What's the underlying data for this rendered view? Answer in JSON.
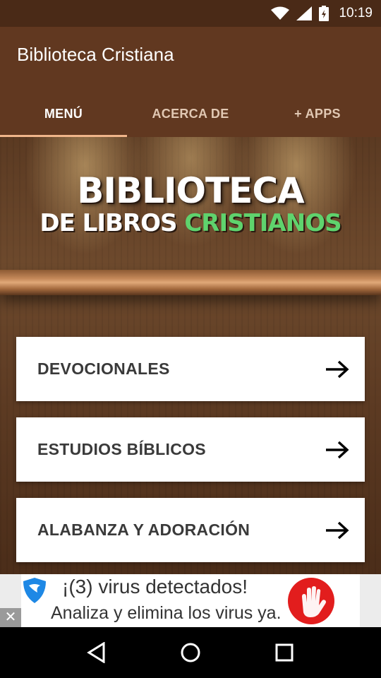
{
  "status_bar": {
    "time": "10:19"
  },
  "app_bar": {
    "title": "Biblioteca Cristiana"
  },
  "tabs": [
    {
      "label": "MENÚ",
      "active": true
    },
    {
      "label": "ACERCA DE",
      "active": false
    },
    {
      "label": "+ APPS",
      "active": false
    }
  ],
  "banner": {
    "line1": "BIBLIOTECA",
    "line2_part1": "DE LIBROS",
    "line2_part2": "CRISTIANOS"
  },
  "menu": [
    {
      "label": "DEVOCIONALES",
      "icon": "arrow-right-icon"
    },
    {
      "label": "ESTUDIOS BÍBLICOS",
      "icon": "arrow-right-icon"
    },
    {
      "label": "ALABANZA Y ADORACIÓN",
      "icon": "arrow-right-icon"
    }
  ],
  "ad": {
    "line1": "¡(3) virus detectados!",
    "line2": "Analiza y elimina los virus ya.",
    "close": "✕"
  },
  "colors": {
    "app_bar": "#613820",
    "status_bar": "#4a2a17",
    "tab_indicator": "#f0b58a",
    "accent_green": "#5fd36d"
  }
}
